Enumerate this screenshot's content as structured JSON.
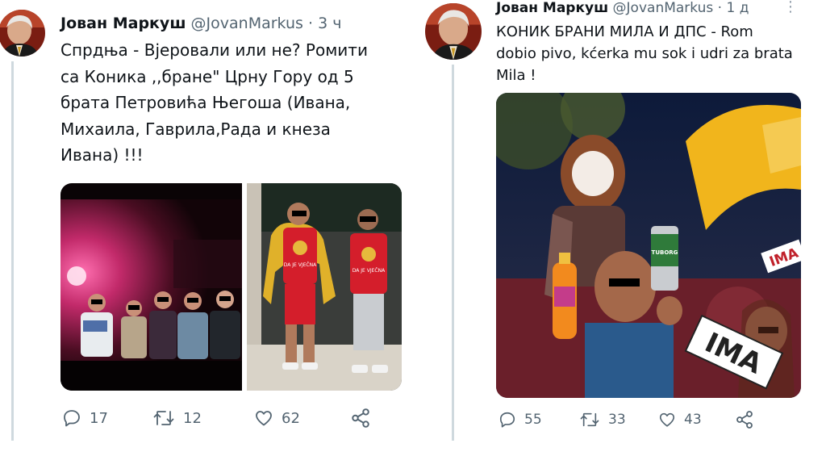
{
  "tweets": [
    {
      "author_name": "Јован Маркуш",
      "handle": "@JovanMarkus",
      "separator": "·",
      "time": "3 ч",
      "text_lines": [
        "Спрдња - Вјеровали или не? Ромити",
        "са Коника ,,бране\" Црну Гору од 5",
        "брата Петровића Његоша (Ивана,",
        "Михаила, Гаврила,Рада и кнеза",
        "Ивана) !!!"
      ],
      "media_captions": [
        "DA JE VJEČNA",
        "DA JE VJEČNA"
      ],
      "replies": "17",
      "retweets": "12",
      "likes": "62"
    },
    {
      "author_name": "Јован Маркуш",
      "handle": "@JovanMarkus",
      "separator": "·",
      "time": "1 д",
      "text_lines": [
        "КОНИК БРАНИ МИЛА И ДПС - Rom",
        "dobio pivo, kćerka mu sok i udri za brata",
        "Mila !"
      ],
      "media_signs": [
        "IMA",
        "IMA"
      ],
      "can_label": "TUBORG",
      "replies": "55",
      "retweets": "33",
      "likes": "43"
    }
  ],
  "icons": {
    "reply": "reply-icon",
    "retweet": "retweet-icon",
    "like": "heart-icon",
    "share": "share-icon",
    "more": "more-icon"
  },
  "colors": {
    "text": "#0f1419",
    "secondary": "#536471",
    "thread_line": "#cfd9de"
  }
}
